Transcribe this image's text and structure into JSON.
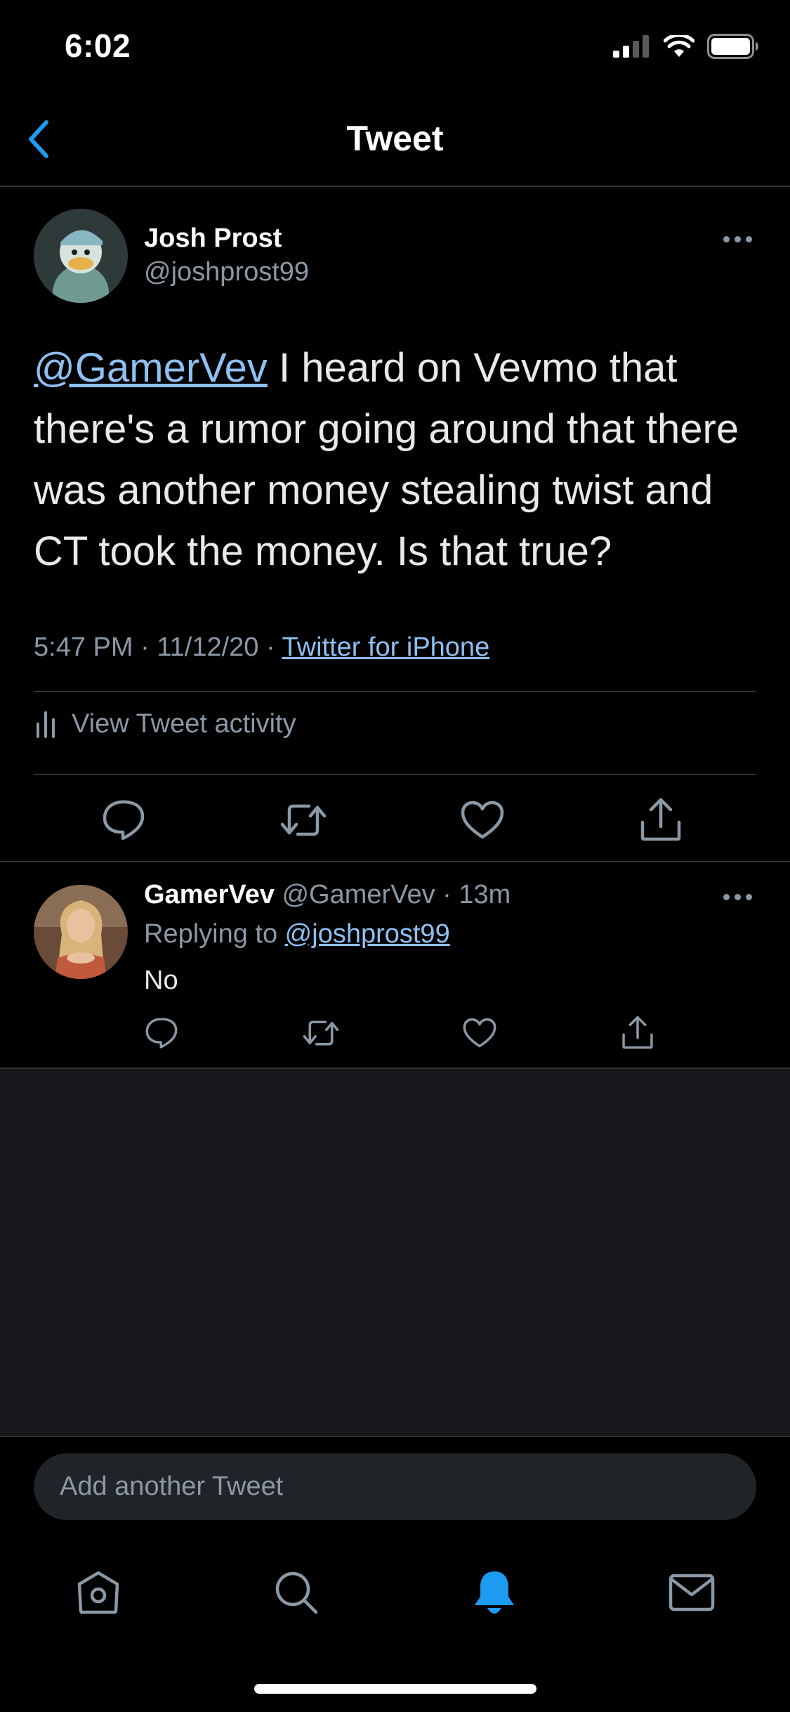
{
  "status_bar": {
    "time": "6:02"
  },
  "header": {
    "title": "Tweet"
  },
  "main_tweet": {
    "author_name": "Josh Prost",
    "author_handle": "@joshprost99",
    "mention": "@GamerVev",
    "body": " I heard on Vevmo that there's a rumor going around that there was another money stealing twist and CT took the money. Is that true?",
    "time": "5:47 PM",
    "date": "11/12/20",
    "separator": " · ",
    "source": "Twitter for iPhone",
    "activity_label": "View Tweet activity"
  },
  "reply": {
    "author_name": "GamerVev",
    "author_handle": "@GamerVev",
    "separator": " · ",
    "time_ago": "13m",
    "replying_to_prefix": "Replying to ",
    "replying_to_handle": "@joshprost99",
    "body": "No"
  },
  "composer": {
    "placeholder": "Add another Tweet"
  },
  "icons": {
    "back": "chevron-left-icon",
    "more": "more-horizontal-icon",
    "reply": "reply-icon",
    "retweet": "retweet-icon",
    "like": "heart-icon",
    "share": "share-icon",
    "activity": "bar-chart-icon",
    "tab_home": "home-icon",
    "tab_search": "search-icon",
    "tab_notifications": "bell-icon",
    "tab_messages": "mail-icon"
  },
  "colors": {
    "background": "#000000",
    "accent": "#1d9bf0",
    "link": "#8ec0f2",
    "secondary_text": "#8b98a5",
    "divider": "#2f3336",
    "empty_area": "#16181c"
  }
}
